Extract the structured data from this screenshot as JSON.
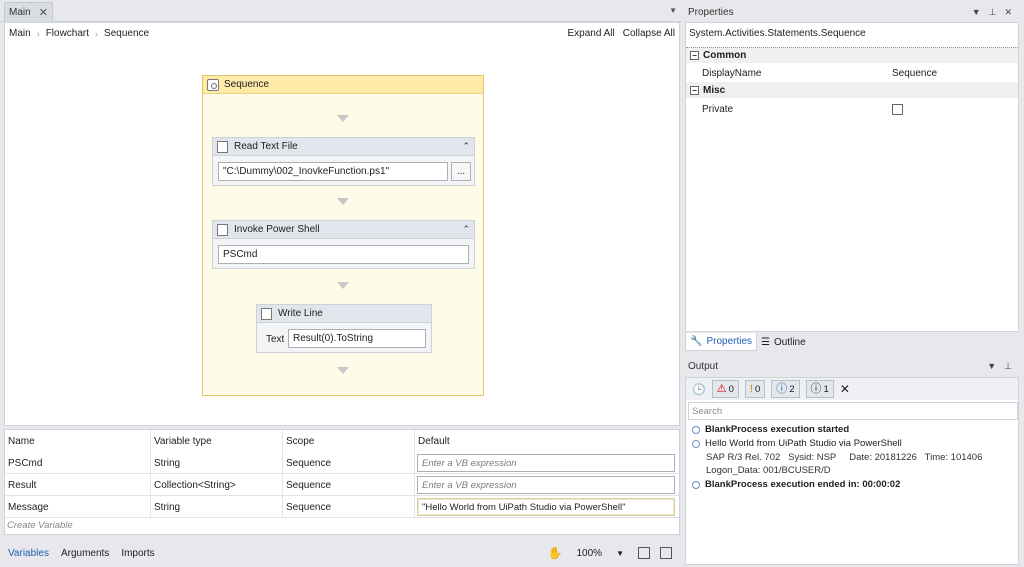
{
  "designer": {
    "doc_tab": "Main",
    "breadcrumb": [
      "Main",
      "Flowchart",
      "Sequence"
    ],
    "expand_all": "Expand All",
    "collapse_all": "Collapse All"
  },
  "sequence": {
    "title": "Sequence",
    "read_text_file": {
      "title": "Read Text File",
      "path": "\"C:\\Dummy\\002_InovkeFunction.ps1\"",
      "browse": "..."
    },
    "invoke_power_shell": {
      "title": "Invoke Power Shell",
      "command": "PSCmd"
    },
    "write_line": {
      "title": "Write Line",
      "text_label": "Text",
      "text_value": "Result(0).ToString"
    }
  },
  "variables": {
    "headers": [
      "Name",
      "Variable type",
      "Scope",
      "Default"
    ],
    "rows": [
      {
        "name": "PSCmd",
        "type": "String",
        "scope": "Sequence",
        "default": "Enter a VB expression"
      },
      {
        "name": "Result",
        "type": "Collection<String>",
        "scope": "Sequence",
        "default": "Enter a VB expression"
      },
      {
        "name": "Message",
        "type": "String",
        "scope": "Sequence",
        "default": "\"Hello World from UiPath Studio via PowerShell\""
      }
    ],
    "create": "Create Variable"
  },
  "bottom_tabs": [
    "Variables",
    "Arguments",
    "Imports"
  ],
  "zoom": "100%",
  "properties": {
    "title": "Properties",
    "type_name": "System.Activities.Statements.Sequence",
    "categories": [
      {
        "name": "Common",
        "items": [
          {
            "name": "DisplayName",
            "value": "Sequence"
          }
        ]
      },
      {
        "name": "Misc",
        "items": [
          {
            "name": "Private",
            "value": ""
          }
        ]
      }
    ],
    "tabs": [
      "Properties",
      "Outline"
    ]
  },
  "output": {
    "title": "Output",
    "filters": {
      "errors": "0",
      "warnings": "0",
      "info": "2",
      "trace": "1"
    },
    "search_placeholder": "Search",
    "logs": [
      {
        "text": "BlankProcess execution started",
        "bold": true
      },
      {
        "text": "Hello World from UiPath Studio via PowerShell",
        "bold": false,
        "details": [
          "SAP R/3 Rel. 702   Sysid: NSP     Date: 20181226   Time: 101406",
          "Logon_Data: 001/BCUSER/D"
        ]
      },
      {
        "text": "BlankProcess execution ended in: 00:00:02",
        "bold": true
      }
    ]
  }
}
